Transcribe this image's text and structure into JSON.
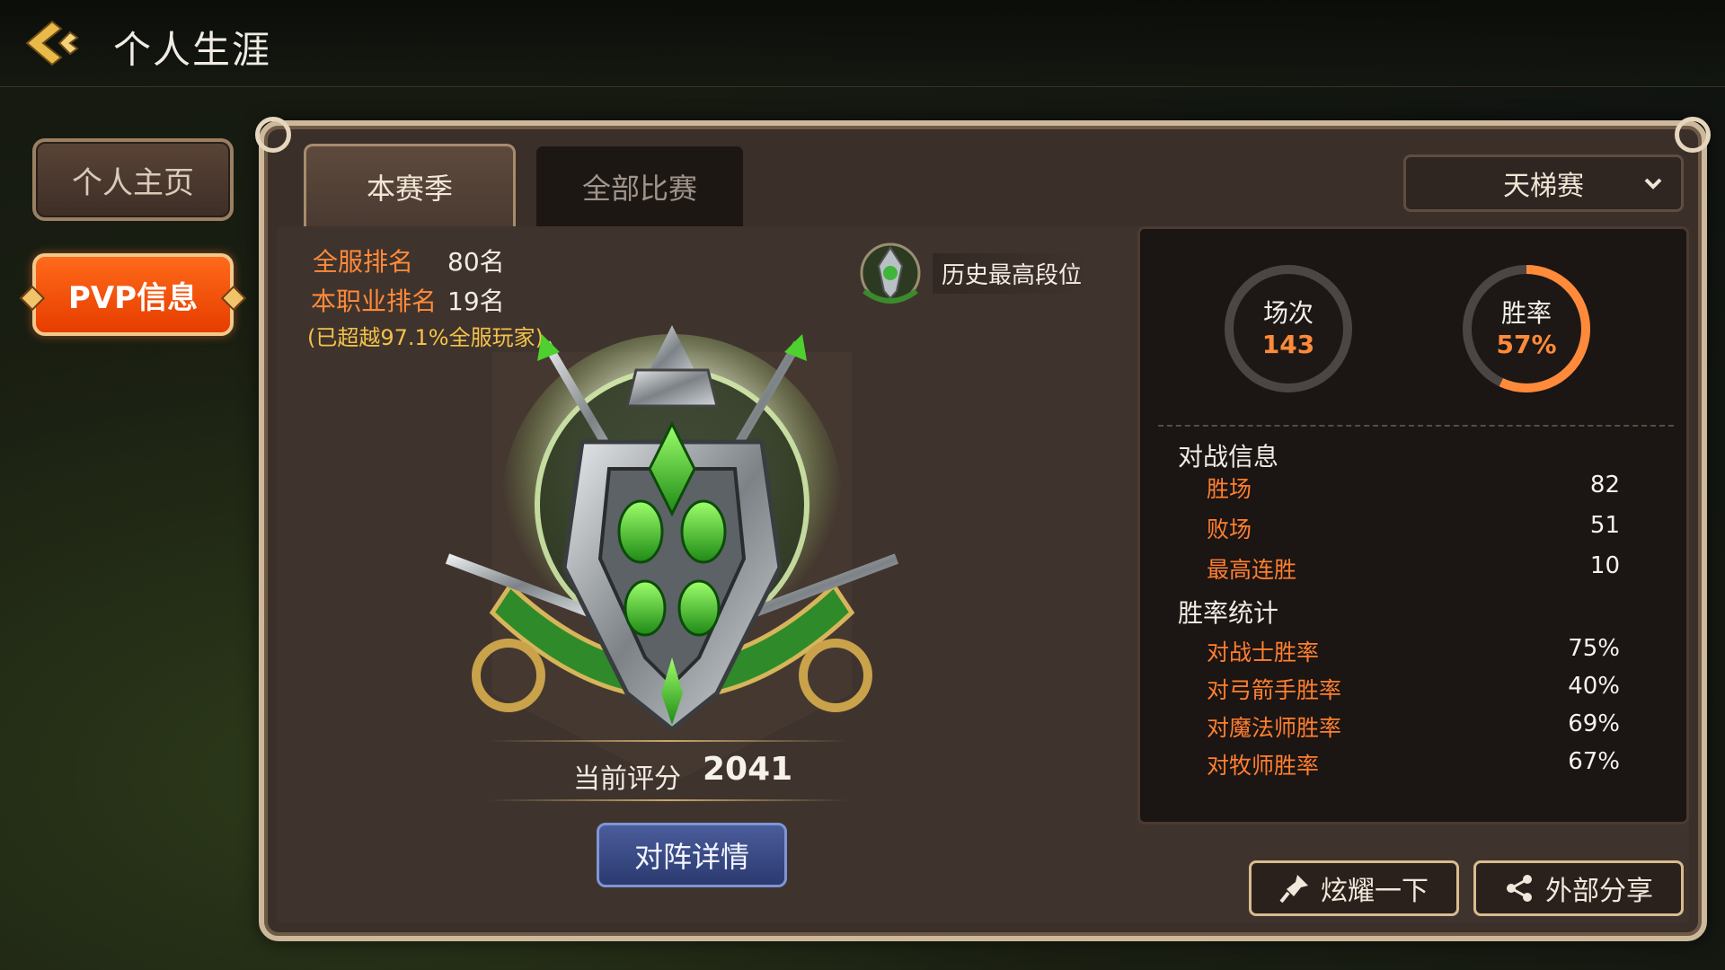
{
  "header": {
    "title": "个人生涯"
  },
  "sidebar": {
    "home_label": "个人主页",
    "pvp_label": "PVP信息"
  },
  "tabs": {
    "season": "本赛季",
    "all": "全部比赛"
  },
  "dropdown": {
    "selected": "天梯赛"
  },
  "ranking": {
    "server_label": "全服排名",
    "server_value": "80名",
    "class_label": "本职业排名",
    "class_value": "19名",
    "note": "(已超越97.1%全服玩家)"
  },
  "history": {
    "label": "历史最高段位"
  },
  "score": {
    "label": "当前评分",
    "value": "2041"
  },
  "detail_button": "对阵详情",
  "summary": {
    "matches_title": "场次",
    "matches_value": "143",
    "winrate_title": "胜率",
    "winrate_value": "57%",
    "winrate_fraction": 0.57
  },
  "battle_info": {
    "title": "对战信息",
    "rows": [
      {
        "name": "胜场",
        "value": "82"
      },
      {
        "name": "败场",
        "value": "51"
      },
      {
        "name": "最高连胜",
        "value": "10"
      }
    ]
  },
  "winrate_stats": {
    "title": "胜率统计",
    "rows": [
      {
        "name": "对战士胜率",
        "value": "75%"
      },
      {
        "name": "对弓箭手胜率",
        "value": "40%"
      },
      {
        "name": "对魔法师胜率",
        "value": "69%"
      },
      {
        "name": "对牧师胜率",
        "value": "67%"
      }
    ]
  },
  "actions": {
    "show_off": "炫耀一下",
    "share": "外部分享"
  },
  "colors": {
    "accent_orange": "#ff8a3a",
    "pvp_button": "#e63d00",
    "gold_border": "#cdb89c"
  }
}
